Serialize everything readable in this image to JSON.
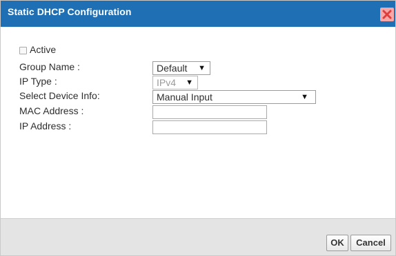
{
  "dialog": {
    "title": "Static DHCP Configuration"
  },
  "form": {
    "active_label": "Active",
    "group_name_label": "Group Name :",
    "group_name_value": "Default",
    "ip_type_label": "IP Type :",
    "ip_type_value": "IPv4",
    "device_info_label": "Select Device Info:",
    "device_info_value": "Manual Input",
    "mac_label": "MAC Address :",
    "ip_label": "IP Address :"
  },
  "buttons": {
    "ok": "OK",
    "cancel": "Cancel"
  },
  "colors": {
    "titlebar": "#1e6fb3",
    "close_bg": "#f6a8a8",
    "close_x": "#e03c3c"
  },
  "icons": {
    "close": "close-icon",
    "dropdown": "chevron-down-icon"
  }
}
